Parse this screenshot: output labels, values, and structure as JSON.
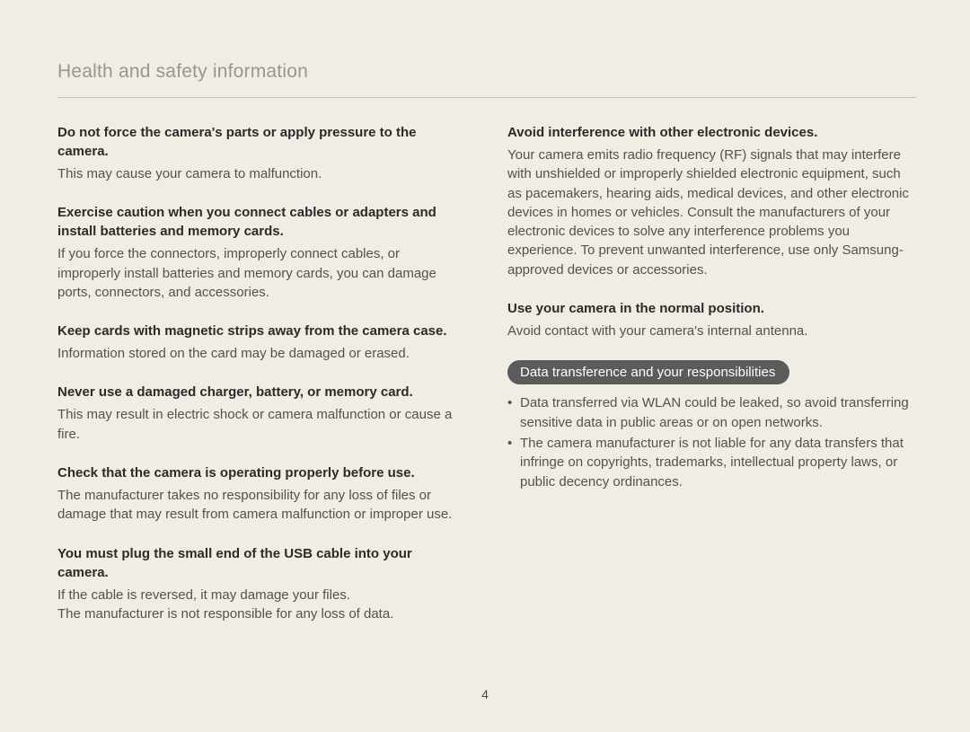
{
  "page_title": "Health and safety information",
  "page_number": "4",
  "left": {
    "b1": {
      "h": "Do not force the camera's parts or apply pressure to the camera.",
      "t": "This may cause your camera to malfunction."
    },
    "b2": {
      "h": "Exercise caution when you connect cables or adapters and install batteries and memory cards.",
      "t": "If you force the connectors, improperly connect cables, or improperly install batteries and memory cards, you can damage ports, connectors, and accessories."
    },
    "b3": {
      "h": "Keep cards with magnetic strips away from the camera case.",
      "t": "Information stored on the card may be damaged or erased."
    },
    "b4": {
      "h": "Never use a damaged charger, battery, or memory card.",
      "t": "This may result in electric shock or camera malfunction or cause a fire."
    },
    "b5": {
      "h": "Check that the camera is operating properly before use.",
      "t": "The manufacturer takes no responsibility for any loss of files or damage that may result from camera malfunction or improper use."
    },
    "b6": {
      "h": "You must plug the small end of the USB cable into your camera.",
      "t1": "If the cable is reversed, it may damage your files.",
      "t2": "The manufacturer is not responsible for any loss of data."
    }
  },
  "right": {
    "b1": {
      "h": "Avoid interference with other electronic devices.",
      "t": "Your camera emits radio frequency (RF) signals that may interfere with unshielded or improperly shielded electronic equipment, such as pacemakers, hearing aids, medical devices, and other electronic devices in homes or vehicles. Consult the manufacturers of your electronic devices to solve any interference problems you experience. To prevent unwanted interference, use only Samsung-approved devices or accessories."
    },
    "b2": {
      "h": "Use your camera in the normal position.",
      "t": "Avoid contact with your camera's internal antenna."
    },
    "section": {
      "title": "Data transference and your responsibilities",
      "items": [
        "Data transferred via WLAN could be leaked, so avoid transferring sensitive data in public areas or on open networks.",
        "The camera manufacturer is not liable for any data transfers that infringe on copyrights, trademarks, intellectual property laws, or public decency ordinances."
      ]
    }
  }
}
